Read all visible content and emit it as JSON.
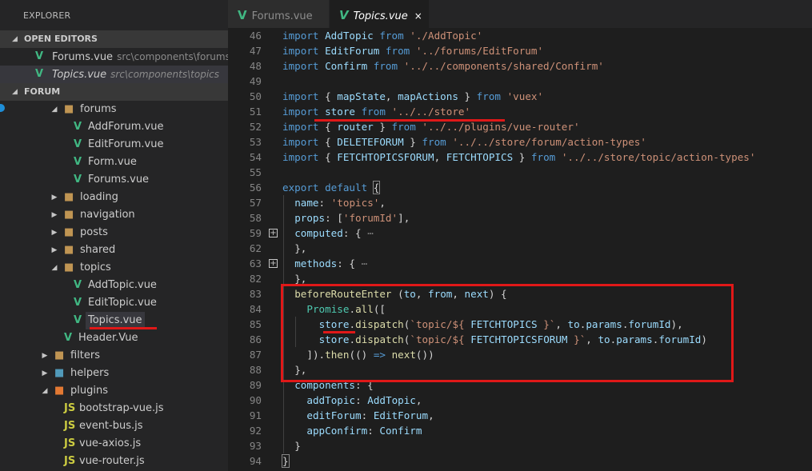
{
  "sidebar": {
    "title": "EXPLORER",
    "open_editors": {
      "header": "OPEN EDITORS",
      "items": [
        {
          "name": "Forums.vue",
          "path": "src\\components\\forums"
        },
        {
          "name": "Topics.vue",
          "path": "src\\components\\topics"
        }
      ]
    },
    "project": {
      "header": "FORUM",
      "tree": [
        {
          "label": "forums",
          "type": "folder",
          "expanded": true
        },
        {
          "label": "AddForum.vue",
          "type": "vue"
        },
        {
          "label": "EditForum.vue",
          "type": "vue"
        },
        {
          "label": "Form.vue",
          "type": "vue"
        },
        {
          "label": "Forums.vue",
          "type": "vue"
        },
        {
          "label": "loading",
          "type": "folder",
          "expanded": false
        },
        {
          "label": "navigation",
          "type": "folder",
          "expanded": false
        },
        {
          "label": "posts",
          "type": "folder",
          "expanded": false
        },
        {
          "label": "shared",
          "type": "folder",
          "expanded": false
        },
        {
          "label": "topics",
          "type": "folder",
          "expanded": true
        },
        {
          "label": "AddTopic.vue",
          "type": "vue"
        },
        {
          "label": "EditTopic.vue",
          "type": "vue"
        },
        {
          "label": "Topics.vue",
          "type": "vue",
          "selected": true
        },
        {
          "label": "Header.Vue",
          "type": "vue"
        },
        {
          "label": "filters",
          "type": "folder",
          "expanded": false
        },
        {
          "label": "helpers",
          "type": "folder",
          "expanded": false
        },
        {
          "label": "plugins",
          "type": "folder",
          "expanded": true
        },
        {
          "label": "bootstrap-vue.js",
          "type": "js"
        },
        {
          "label": "event-bus.js",
          "type": "js"
        },
        {
          "label": "vue-axios.js",
          "type": "js"
        },
        {
          "label": "vue-router.js",
          "type": "js"
        }
      ]
    }
  },
  "tabs": [
    {
      "label": "Forums.vue",
      "active": false
    },
    {
      "label": "Topics.vue",
      "active": true,
      "close": "×"
    }
  ],
  "icons": {
    "vue": "V",
    "js": "JS",
    "folder": "folder-icon",
    "expand_collapsed": "▶",
    "expand_open": "◢",
    "fold_plus": "+",
    "ellipsis": "⋯"
  },
  "colors": {
    "accent_red": "#e01818",
    "vue_green": "#41b883",
    "js_yellow": "#cbcb41",
    "keyword": "#569cd6",
    "string": "#ce9178",
    "variable": "#9cdcfe",
    "function": "#dcdcaa"
  },
  "editor": {
    "lines": [
      {
        "n": "46",
        "code": [
          [
            "k",
            "import "
          ],
          [
            "i",
            "AddTopic "
          ],
          [
            "k",
            "from "
          ],
          [
            "s",
            "'./AddTopic'"
          ]
        ]
      },
      {
        "n": "47",
        "code": [
          [
            "k",
            "import "
          ],
          [
            "i",
            "EditForum "
          ],
          [
            "k",
            "from "
          ],
          [
            "s",
            "'../forums/EditForum'"
          ]
        ]
      },
      {
        "n": "48",
        "code": [
          [
            "k",
            "import "
          ],
          [
            "i",
            "Confirm "
          ],
          [
            "k",
            "from "
          ],
          [
            "s",
            "'../../components/shared/Confirm'"
          ]
        ]
      },
      {
        "n": "49",
        "code": []
      },
      {
        "n": "50",
        "code": [
          [
            "k",
            "import "
          ],
          [
            "p",
            "{ "
          ],
          [
            "i",
            "mapState"
          ],
          [
            "p",
            ", "
          ],
          [
            "i",
            "mapActions "
          ],
          [
            "p",
            "} "
          ],
          [
            "k",
            "from "
          ],
          [
            "s",
            "'vuex'"
          ]
        ]
      },
      {
        "n": "51",
        "code": [
          [
            "k",
            "import "
          ],
          [
            "i",
            "store "
          ],
          [
            "k",
            "from "
          ],
          [
            "s",
            "'../../store'"
          ]
        ]
      },
      {
        "n": "52",
        "code": [
          [
            "k",
            "import "
          ],
          [
            "p",
            "{ "
          ],
          [
            "i",
            "router "
          ],
          [
            "p",
            "} "
          ],
          [
            "k",
            "from "
          ],
          [
            "s",
            "'../../plugins/vue-router'"
          ]
        ]
      },
      {
        "n": "53",
        "code": [
          [
            "k",
            "import "
          ],
          [
            "p",
            "{ "
          ],
          [
            "i",
            "DELETEFORUM "
          ],
          [
            "p",
            "} "
          ],
          [
            "k",
            "from "
          ],
          [
            "s",
            "'../../store/forum/action-types'"
          ]
        ]
      },
      {
        "n": "54",
        "code": [
          [
            "k",
            "import "
          ],
          [
            "p",
            "{ "
          ],
          [
            "i",
            "FETCHTOPICSFORUM"
          ],
          [
            "p",
            ", "
          ],
          [
            "i",
            "FETCHTOPICS "
          ],
          [
            "p",
            "} "
          ],
          [
            "k",
            "from "
          ],
          [
            "s",
            "'../../store/topic/action-types'"
          ]
        ]
      },
      {
        "n": "55",
        "code": []
      },
      {
        "n": "56",
        "code": [
          [
            "k",
            "export "
          ],
          [
            "k",
            "default "
          ],
          [
            "b",
            "{"
          ]
        ],
        "indent": 0
      },
      {
        "n": "57",
        "code": [
          [
            "i",
            "name"
          ],
          [
            "p",
            ": "
          ],
          [
            "s",
            "'topics'"
          ],
          [
            "p",
            ","
          ]
        ],
        "indent": 1
      },
      {
        "n": "58",
        "code": [
          [
            "i",
            "props"
          ],
          [
            "p",
            ": ["
          ],
          [
            "s",
            "'forumId'"
          ],
          [
            "p",
            "],"
          ]
        ],
        "indent": 1
      },
      {
        "n": "59",
        "code": [
          [
            "i",
            "computed"
          ],
          [
            "p",
            ": { "
          ],
          [
            "e",
            "⋯"
          ]
        ],
        "indent": 1,
        "fold": true
      },
      {
        "n": "62",
        "code": [
          [
            "p",
            "},"
          ]
        ],
        "indent": 1
      },
      {
        "n": "63",
        "code": [
          [
            "i",
            "methods"
          ],
          [
            "p",
            ": { "
          ],
          [
            "e",
            "⋯"
          ]
        ],
        "indent": 1,
        "fold": true
      },
      {
        "n": "82",
        "code": [
          [
            "p",
            "},"
          ]
        ],
        "indent": 1
      },
      {
        "n": "83",
        "code": [
          [
            "f",
            "beforeRouteEnter "
          ],
          [
            "p",
            "("
          ],
          [
            "i",
            "to"
          ],
          [
            "p",
            ", "
          ],
          [
            "i",
            "from"
          ],
          [
            "p",
            ", "
          ],
          [
            "i",
            "next"
          ],
          [
            "p",
            ") {"
          ]
        ],
        "indent": 1
      },
      {
        "n": "84",
        "code": [
          [
            "t",
            "Promise"
          ],
          [
            "p",
            "."
          ],
          [
            "f",
            "all"
          ],
          [
            "p",
            "(["
          ]
        ],
        "indent": 2
      },
      {
        "n": "85",
        "code": [
          [
            "i",
            "store"
          ],
          [
            "p",
            "."
          ],
          [
            "f",
            "dispatch"
          ],
          [
            "p",
            "("
          ],
          [
            "s",
            "`topic/${ "
          ],
          [
            "i",
            "FETCHTOPICS "
          ],
          [
            "s",
            "}`"
          ],
          [
            "p",
            ", "
          ],
          [
            "i",
            "to"
          ],
          [
            "p",
            "."
          ],
          [
            "i",
            "params"
          ],
          [
            "p",
            "."
          ],
          [
            "i",
            "forumId"
          ],
          [
            "p",
            "),"
          ]
        ],
        "indent": 3
      },
      {
        "n": "86",
        "code": [
          [
            "i",
            "store"
          ],
          [
            "p",
            "."
          ],
          [
            "f",
            "dispatch"
          ],
          [
            "p",
            "("
          ],
          [
            "s",
            "`topic/${ "
          ],
          [
            "i",
            "FETCHTOPICSFORUM "
          ],
          [
            "s",
            "}`"
          ],
          [
            "p",
            ", "
          ],
          [
            "i",
            "to"
          ],
          [
            "p",
            "."
          ],
          [
            "i",
            "params"
          ],
          [
            "p",
            "."
          ],
          [
            "i",
            "forumId"
          ],
          [
            "p",
            ")"
          ]
        ],
        "indent": 3
      },
      {
        "n": "87",
        "code": [
          [
            "p",
            "])."
          ],
          [
            "f",
            "then"
          ],
          [
            "p",
            "(() "
          ],
          [
            "k",
            "=> "
          ],
          [
            "f",
            "next"
          ],
          [
            "p",
            "())"
          ]
        ],
        "indent": 2
      },
      {
        "n": "88",
        "code": [
          [
            "p",
            "},"
          ]
        ],
        "indent": 1
      },
      {
        "n": "89",
        "code": [
          [
            "i",
            "components"
          ],
          [
            "p",
            ": {"
          ]
        ],
        "indent": 1
      },
      {
        "n": "90",
        "code": [
          [
            "i",
            "addTopic"
          ],
          [
            "p",
            ": "
          ],
          [
            "i",
            "AddTopic"
          ],
          [
            "p",
            ","
          ]
        ],
        "indent": 2
      },
      {
        "n": "91",
        "code": [
          [
            "i",
            "editForum"
          ],
          [
            "p",
            ": "
          ],
          [
            "i",
            "EditForum"
          ],
          [
            "p",
            ","
          ]
        ],
        "indent": 2
      },
      {
        "n": "92",
        "code": [
          [
            "i",
            "appConfirm"
          ],
          [
            "p",
            ": "
          ],
          [
            "i",
            "Confirm"
          ]
        ],
        "indent": 2
      },
      {
        "n": "93",
        "code": [
          [
            "p",
            "}"
          ]
        ],
        "indent": 1
      },
      {
        "n": "94",
        "code": [
          [
            "b",
            "}"
          ]
        ],
        "indent": 0
      }
    ]
  }
}
